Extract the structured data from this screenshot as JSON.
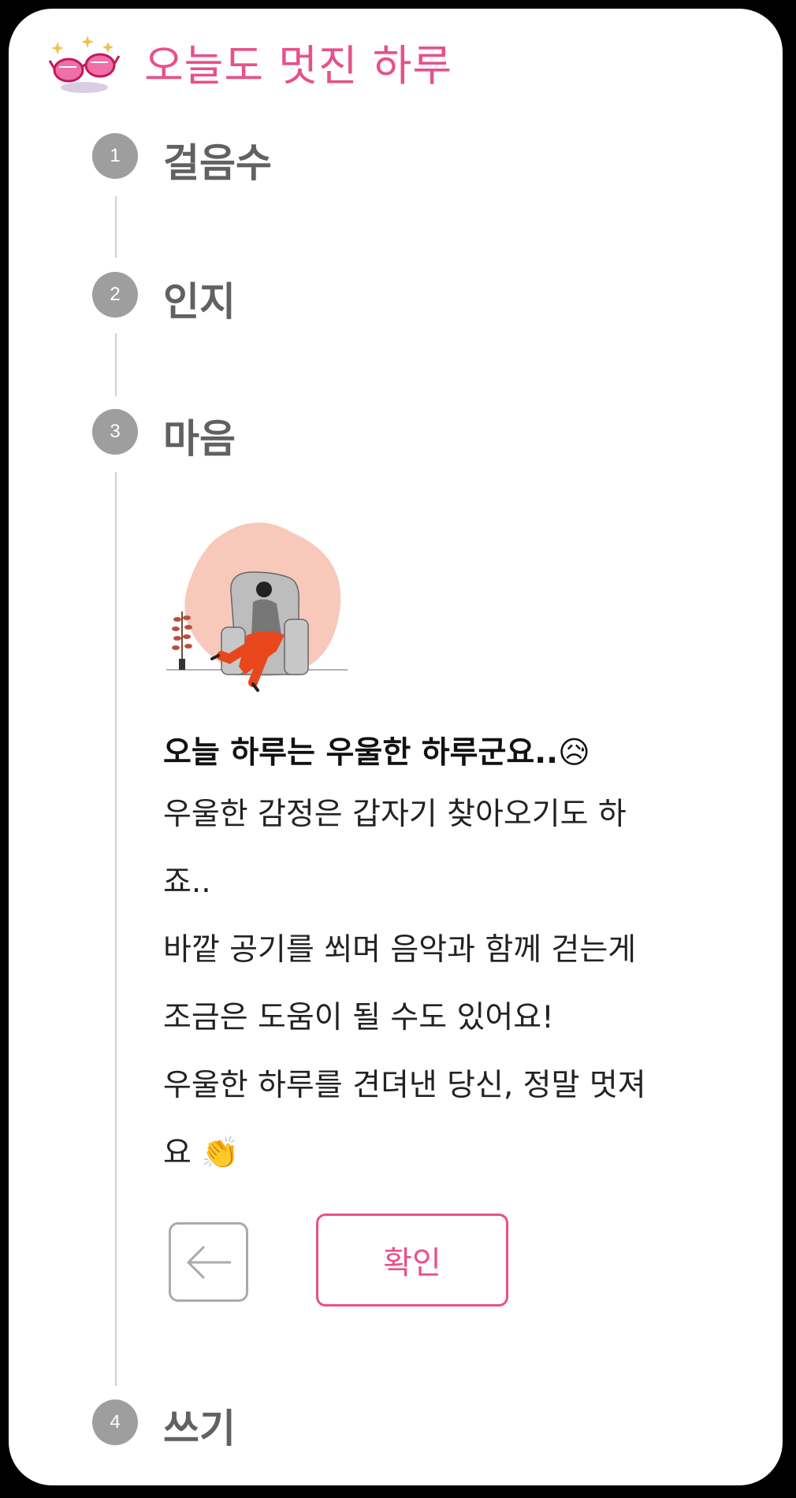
{
  "header": {
    "title": "오늘도 멋진 하루",
    "logo_icon": "sparkle-glasses-icon"
  },
  "steps": [
    {
      "number": "1",
      "label": "걸음수",
      "state": "done"
    },
    {
      "number": "2",
      "label": "인지",
      "state": "done"
    },
    {
      "number": "3",
      "label": "마음",
      "state": "active"
    },
    {
      "number": "4",
      "label": "쓰기",
      "state": "pending"
    }
  ],
  "mood_result": {
    "illustration": "woman-sitting-armchair-illustration",
    "heading": "오늘 하루는 우울한 하루군요..",
    "heading_emoji": "😥",
    "lines": [
      "우울한 감정은 갑자기 찾아오기도 하",
      "죠..",
      "바깥 공기를 쐬며 음악과 함께 걷는게",
      "조금은 도움이 될 수도 있어요!",
      "우울한 하루를 견뎌낸 당신, 정말 멋져",
      "요"
    ],
    "closing_emoji": "👏"
  },
  "actions": {
    "back_icon": "arrow-left-icon",
    "confirm_label": "확인"
  },
  "colors": {
    "accent": "#e8508a",
    "step_circle": "#9e9e9e",
    "step_title": "#616161",
    "line": "#d0d0d0"
  }
}
